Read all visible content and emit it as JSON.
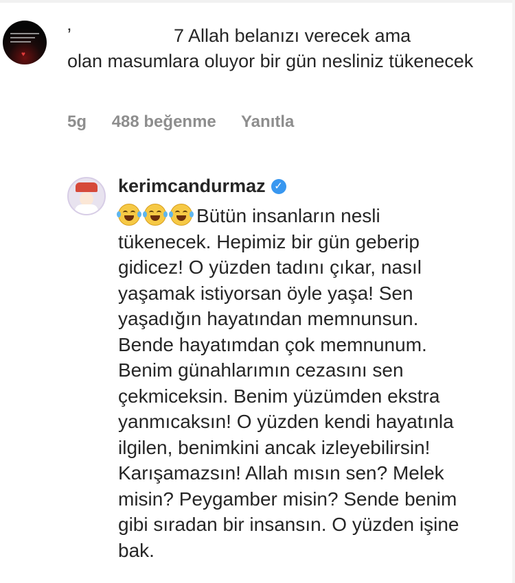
{
  "comment": {
    "text_line1": "7 Allah belanızı verecek ama",
    "text_rest": "olan masumlara oluyor bir gün nesliniz tükenecek",
    "time": "5g",
    "likes": "488 beğenme",
    "reply_label": "Yanıtla"
  },
  "reply": {
    "username": "kerimcandurmaz",
    "emoji_icons": [
      "face-with-tears-of-joy-icon",
      "face-with-tears-of-joy-icon",
      "face-with-tears-of-joy-icon"
    ],
    "text": "Bütün insanların nesli tükenecek. Hepimiz bir gün geberip gidicez! O yüzden tadını çıkar, nasıl yaşamak istiyorsan öyle yaşa! Sen yaşadığın hayatından memnunsun. Bende hayatımdan çok memnunum. Benim günahlarımın cezasını sen çekmiceksin. Benim yüzümden ekstra yanmıcaksın! O yüzden kendi hayatınla ilgilen, benimkini ancak izleyebilirsin! Karışamazsın! Allah mısın sen? Melek misin? Peygamber misin? Sende benim gibi sıradan bir insansın. O yüzden işine bak."
  },
  "colors": {
    "text": "#262626",
    "meta": "#8e8e8e",
    "verified": "#3897f0"
  }
}
